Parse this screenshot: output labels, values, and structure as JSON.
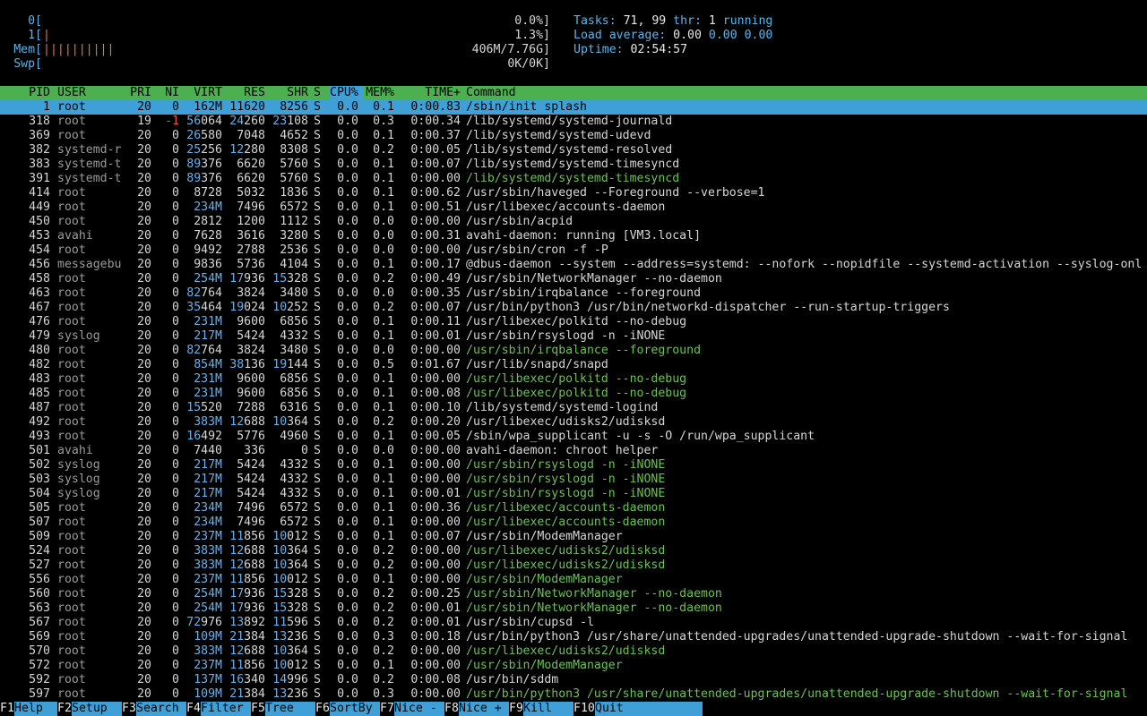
{
  "meters": {
    "cpu0": {
      "label": "0[",
      "value": "0.0%]"
    },
    "cpu1": {
      "label": "1[",
      "bar": "|",
      "value": "1.3%]"
    },
    "mem": {
      "label": "Mem[",
      "bar": "||||||||||",
      "value": "406M/7.76G]"
    },
    "swp": {
      "label": "Swp[",
      "value": "0K/0K]"
    }
  },
  "stats": {
    "tasks_label": "Tasks: ",
    "tasks_value": "71, 99",
    "thr_label": " thr: ",
    "thr_value": "1",
    "running": " running",
    "load_label": "Load average: ",
    "load1": "0.00",
    "load5": "0.00",
    "load15": "0.00",
    "uptime_label": "Uptime: ",
    "uptime_value": "02:54:57"
  },
  "columns": [
    "PID",
    "USER",
    "PRI",
    "NI",
    "VIRT",
    "RES",
    "SHR",
    "S",
    "CPU%",
    "MEM%",
    "TIME+",
    "Command"
  ],
  "sort_column": "CPU%",
  "processes": [
    {
      "pid": "1",
      "user": "root",
      "pri": "20",
      "ni": "0",
      "virt": "162M",
      "res": "11620",
      "shr": "8256",
      "s": "S",
      "cpu": "0.0",
      "mem": "0.1",
      "time": "0:00.83",
      "cmd": "/sbin/init splash",
      "thread": false,
      "selected": true
    },
    {
      "pid": "318",
      "user": "root",
      "pri": "19",
      "ni": "-1",
      "virt": "56064",
      "res": "24260",
      "shr": "23108",
      "s": "S",
      "cpu": "0.0",
      "mem": "0.3",
      "time": "0:00.34",
      "cmd": "/lib/systemd/systemd-journald",
      "thread": false
    },
    {
      "pid": "369",
      "user": "root",
      "pri": "20",
      "ni": "0",
      "virt": "26580",
      "res": "7048",
      "shr": "4652",
      "s": "S",
      "cpu": "0.0",
      "mem": "0.1",
      "time": "0:00.37",
      "cmd": "/lib/systemd/systemd-udevd",
      "thread": false
    },
    {
      "pid": "382",
      "user": "systemd-r",
      "pri": "20",
      "ni": "0",
      "virt": "25256",
      "res": "12280",
      "shr": "8308",
      "s": "S",
      "cpu": "0.0",
      "mem": "0.2",
      "time": "0:00.05",
      "cmd": "/lib/systemd/systemd-resolved",
      "thread": false
    },
    {
      "pid": "383",
      "user": "systemd-t",
      "pri": "20",
      "ni": "0",
      "virt": "89376",
      "res": "6620",
      "shr": "5760",
      "s": "S",
      "cpu": "0.0",
      "mem": "0.1",
      "time": "0:00.07",
      "cmd": "/lib/systemd/systemd-timesyncd",
      "thread": false
    },
    {
      "pid": "391",
      "user": "systemd-t",
      "pri": "20",
      "ni": "0",
      "virt": "89376",
      "res": "6620",
      "shr": "5760",
      "s": "S",
      "cpu": "0.0",
      "mem": "0.1",
      "time": "0:00.00",
      "cmd": "/lib/systemd/systemd-timesyncd",
      "thread": true
    },
    {
      "pid": "414",
      "user": "root",
      "pri": "20",
      "ni": "0",
      "virt": "8728",
      "res": "5032",
      "shr": "1836",
      "s": "S",
      "cpu": "0.0",
      "mem": "0.1",
      "time": "0:00.62",
      "cmd": "/usr/sbin/haveged --Foreground --verbose=1",
      "thread": false
    },
    {
      "pid": "449",
      "user": "root",
      "pri": "20",
      "ni": "0",
      "virt": "234M",
      "res": "7496",
      "shr": "6572",
      "s": "S",
      "cpu": "0.0",
      "mem": "0.1",
      "time": "0:00.51",
      "cmd": "/usr/libexec/accounts-daemon",
      "thread": false
    },
    {
      "pid": "450",
      "user": "root",
      "pri": "20",
      "ni": "0",
      "virt": "2812",
      "res": "1200",
      "shr": "1112",
      "s": "S",
      "cpu": "0.0",
      "mem": "0.0",
      "time": "0:00.00",
      "cmd": "/usr/sbin/acpid",
      "thread": false
    },
    {
      "pid": "453",
      "user": "avahi",
      "pri": "20",
      "ni": "0",
      "virt": "7628",
      "res": "3616",
      "shr": "3280",
      "s": "S",
      "cpu": "0.0",
      "mem": "0.0",
      "time": "0:00.31",
      "cmd": "avahi-daemon: running [VM3.local]",
      "thread": false
    },
    {
      "pid": "454",
      "user": "root",
      "pri": "20",
      "ni": "0",
      "virt": "9492",
      "res": "2788",
      "shr": "2536",
      "s": "S",
      "cpu": "0.0",
      "mem": "0.0",
      "time": "0:00.00",
      "cmd": "/usr/sbin/cron -f -P",
      "thread": false
    },
    {
      "pid": "456",
      "user": "messagebu",
      "pri": "20",
      "ni": "0",
      "virt": "9836",
      "res": "5736",
      "shr": "4104",
      "s": "S",
      "cpu": "0.0",
      "mem": "0.1",
      "time": "0:00.17",
      "cmd": "@dbus-daemon --system --address=systemd: --nofork --nopidfile --systemd-activation --syslog-onl",
      "thread": false
    },
    {
      "pid": "458",
      "user": "root",
      "pri": "20",
      "ni": "0",
      "virt": "254M",
      "res": "17936",
      "shr": "15328",
      "s": "S",
      "cpu": "0.0",
      "mem": "0.2",
      "time": "0:00.49",
      "cmd": "/usr/sbin/NetworkManager --no-daemon",
      "thread": false
    },
    {
      "pid": "463",
      "user": "root",
      "pri": "20",
      "ni": "0",
      "virt": "82764",
      "res": "3824",
      "shr": "3480",
      "s": "S",
      "cpu": "0.0",
      "mem": "0.0",
      "time": "0:00.35",
      "cmd": "/usr/sbin/irqbalance --foreground",
      "thread": false
    },
    {
      "pid": "467",
      "user": "root",
      "pri": "20",
      "ni": "0",
      "virt": "35464",
      "res": "19024",
      "shr": "10252",
      "s": "S",
      "cpu": "0.0",
      "mem": "0.2",
      "time": "0:00.07",
      "cmd": "/usr/bin/python3 /usr/bin/networkd-dispatcher --run-startup-triggers",
      "thread": false
    },
    {
      "pid": "476",
      "user": "root",
      "pri": "20",
      "ni": "0",
      "virt": "231M",
      "res": "9600",
      "shr": "6856",
      "s": "S",
      "cpu": "0.0",
      "mem": "0.1",
      "time": "0:00.11",
      "cmd": "/usr/libexec/polkitd --no-debug",
      "thread": false
    },
    {
      "pid": "479",
      "user": "syslog",
      "pri": "20",
      "ni": "0",
      "virt": "217M",
      "res": "5424",
      "shr": "4332",
      "s": "S",
      "cpu": "0.0",
      "mem": "0.1",
      "time": "0:00.01",
      "cmd": "/usr/sbin/rsyslogd -n -iNONE",
      "thread": false
    },
    {
      "pid": "480",
      "user": "root",
      "pri": "20",
      "ni": "0",
      "virt": "82764",
      "res": "3824",
      "shr": "3480",
      "s": "S",
      "cpu": "0.0",
      "mem": "0.0",
      "time": "0:00.00",
      "cmd": "/usr/sbin/irqbalance --foreground",
      "thread": true
    },
    {
      "pid": "482",
      "user": "root",
      "pri": "20",
      "ni": "0",
      "virt": "854M",
      "res": "38136",
      "shr": "19144",
      "s": "S",
      "cpu": "0.0",
      "mem": "0.5",
      "time": "0:01.67",
      "cmd": "/usr/lib/snapd/snapd",
      "thread": false
    },
    {
      "pid": "483",
      "user": "root",
      "pri": "20",
      "ni": "0",
      "virt": "231M",
      "res": "9600",
      "shr": "6856",
      "s": "S",
      "cpu": "0.0",
      "mem": "0.1",
      "time": "0:00.00",
      "cmd": "/usr/libexec/polkitd --no-debug",
      "thread": true
    },
    {
      "pid": "485",
      "user": "root",
      "pri": "20",
      "ni": "0",
      "virt": "231M",
      "res": "9600",
      "shr": "6856",
      "s": "S",
      "cpu": "0.0",
      "mem": "0.1",
      "time": "0:00.08",
      "cmd": "/usr/libexec/polkitd --no-debug",
      "thread": true
    },
    {
      "pid": "487",
      "user": "root",
      "pri": "20",
      "ni": "0",
      "virt": "15520",
      "res": "7288",
      "shr": "6316",
      "s": "S",
      "cpu": "0.0",
      "mem": "0.1",
      "time": "0:00.10",
      "cmd": "/lib/systemd/systemd-logind",
      "thread": false
    },
    {
      "pid": "492",
      "user": "root",
      "pri": "20",
      "ni": "0",
      "virt": "383M",
      "res": "12688",
      "shr": "10364",
      "s": "S",
      "cpu": "0.0",
      "mem": "0.2",
      "time": "0:00.20",
      "cmd": "/usr/libexec/udisks2/udisksd",
      "thread": false
    },
    {
      "pid": "493",
      "user": "root",
      "pri": "20",
      "ni": "0",
      "virt": "16492",
      "res": "5776",
      "shr": "4960",
      "s": "S",
      "cpu": "0.0",
      "mem": "0.1",
      "time": "0:00.05",
      "cmd": "/sbin/wpa_supplicant -u -s -O /run/wpa_supplicant",
      "thread": false
    },
    {
      "pid": "501",
      "user": "avahi",
      "pri": "20",
      "ni": "0",
      "virt": "7440",
      "res": "336",
      "shr": "0",
      "s": "S",
      "cpu": "0.0",
      "mem": "0.0",
      "time": "0:00.00",
      "cmd": "avahi-daemon: chroot helper",
      "thread": false
    },
    {
      "pid": "502",
      "user": "syslog",
      "pri": "20",
      "ni": "0",
      "virt": "217M",
      "res": "5424",
      "shr": "4332",
      "s": "S",
      "cpu": "0.0",
      "mem": "0.1",
      "time": "0:00.00",
      "cmd": "/usr/sbin/rsyslogd -n -iNONE",
      "thread": true
    },
    {
      "pid": "503",
      "user": "syslog",
      "pri": "20",
      "ni": "0",
      "virt": "217M",
      "res": "5424",
      "shr": "4332",
      "s": "S",
      "cpu": "0.0",
      "mem": "0.1",
      "time": "0:00.00",
      "cmd": "/usr/sbin/rsyslogd -n -iNONE",
      "thread": true
    },
    {
      "pid": "504",
      "user": "syslog",
      "pri": "20",
      "ni": "0",
      "virt": "217M",
      "res": "5424",
      "shr": "4332",
      "s": "S",
      "cpu": "0.0",
      "mem": "0.1",
      "time": "0:00.01",
      "cmd": "/usr/sbin/rsyslogd -n -iNONE",
      "thread": true
    },
    {
      "pid": "505",
      "user": "root",
      "pri": "20",
      "ni": "0",
      "virt": "234M",
      "res": "7496",
      "shr": "6572",
      "s": "S",
      "cpu": "0.0",
      "mem": "0.1",
      "time": "0:00.36",
      "cmd": "/usr/libexec/accounts-daemon",
      "thread": true
    },
    {
      "pid": "507",
      "user": "root",
      "pri": "20",
      "ni": "0",
      "virt": "234M",
      "res": "7496",
      "shr": "6572",
      "s": "S",
      "cpu": "0.0",
      "mem": "0.1",
      "time": "0:00.00",
      "cmd": "/usr/libexec/accounts-daemon",
      "thread": true
    },
    {
      "pid": "509",
      "user": "root",
      "pri": "20",
      "ni": "0",
      "virt": "237M",
      "res": "11856",
      "shr": "10012",
      "s": "S",
      "cpu": "0.0",
      "mem": "0.1",
      "time": "0:00.07",
      "cmd": "/usr/sbin/ModemManager",
      "thread": false
    },
    {
      "pid": "524",
      "user": "root",
      "pri": "20",
      "ni": "0",
      "virt": "383M",
      "res": "12688",
      "shr": "10364",
      "s": "S",
      "cpu": "0.0",
      "mem": "0.2",
      "time": "0:00.00",
      "cmd": "/usr/libexec/udisks2/udisksd",
      "thread": true
    },
    {
      "pid": "527",
      "user": "root",
      "pri": "20",
      "ni": "0",
      "virt": "383M",
      "res": "12688",
      "shr": "10364",
      "s": "S",
      "cpu": "0.0",
      "mem": "0.2",
      "time": "0:00.00",
      "cmd": "/usr/libexec/udisks2/udisksd",
      "thread": true
    },
    {
      "pid": "556",
      "user": "root",
      "pri": "20",
      "ni": "0",
      "virt": "237M",
      "res": "11856",
      "shr": "10012",
      "s": "S",
      "cpu": "0.0",
      "mem": "0.1",
      "time": "0:00.00",
      "cmd": "/usr/sbin/ModemManager",
      "thread": true
    },
    {
      "pid": "560",
      "user": "root",
      "pri": "20",
      "ni": "0",
      "virt": "254M",
      "res": "17936",
      "shr": "15328",
      "s": "S",
      "cpu": "0.0",
      "mem": "0.2",
      "time": "0:00.25",
      "cmd": "/usr/sbin/NetworkManager --no-daemon",
      "thread": true
    },
    {
      "pid": "563",
      "user": "root",
      "pri": "20",
      "ni": "0",
      "virt": "254M",
      "res": "17936",
      "shr": "15328",
      "s": "S",
      "cpu": "0.0",
      "mem": "0.2",
      "time": "0:00.01",
      "cmd": "/usr/sbin/NetworkManager --no-daemon",
      "thread": true
    },
    {
      "pid": "567",
      "user": "root",
      "pri": "20",
      "ni": "0",
      "virt": "72976",
      "res": "13892",
      "shr": "11596",
      "s": "S",
      "cpu": "0.0",
      "mem": "0.2",
      "time": "0:00.01",
      "cmd": "/usr/sbin/cupsd -l",
      "thread": false
    },
    {
      "pid": "569",
      "user": "root",
      "pri": "20",
      "ni": "0",
      "virt": "109M",
      "res": "21384",
      "shr": "13236",
      "s": "S",
      "cpu": "0.0",
      "mem": "0.3",
      "time": "0:00.18",
      "cmd": "/usr/bin/python3 /usr/share/unattended-upgrades/unattended-upgrade-shutdown --wait-for-signal",
      "thread": false
    },
    {
      "pid": "570",
      "user": "root",
      "pri": "20",
      "ni": "0",
      "virt": "383M",
      "res": "12688",
      "shr": "10364",
      "s": "S",
      "cpu": "0.0",
      "mem": "0.2",
      "time": "0:00.00",
      "cmd": "/usr/libexec/udisks2/udisksd",
      "thread": true
    },
    {
      "pid": "572",
      "user": "root",
      "pri": "20",
      "ni": "0",
      "virt": "237M",
      "res": "11856",
      "shr": "10012",
      "s": "S",
      "cpu": "0.0",
      "mem": "0.1",
      "time": "0:00.00",
      "cmd": "/usr/sbin/ModemManager",
      "thread": true
    },
    {
      "pid": "592",
      "user": "root",
      "pri": "20",
      "ni": "0",
      "virt": "137M",
      "res": "16340",
      "shr": "14996",
      "s": "S",
      "cpu": "0.0",
      "mem": "0.2",
      "time": "0:00.08",
      "cmd": "/usr/bin/sddm",
      "thread": false
    },
    {
      "pid": "597",
      "user": "root",
      "pri": "20",
      "ni": "0",
      "virt": "109M",
      "res": "21384",
      "shr": "13236",
      "s": "S",
      "cpu": "0.0",
      "mem": "0.3",
      "time": "0:00.00",
      "cmd": "/usr/bin/python3 /usr/share/unattended-upgrades/unattended-upgrade-shutdown --wait-for-signal",
      "thread": true
    }
  ],
  "footer": [
    {
      "key": "F1",
      "label": "Help"
    },
    {
      "key": "F2",
      "label": "Setup"
    },
    {
      "key": "F3",
      "label": "Search"
    },
    {
      "key": "F4",
      "label": "Filter"
    },
    {
      "key": "F5",
      "label": "Tree"
    },
    {
      "key": "F6",
      "label": "SortBy"
    },
    {
      "key": "F7",
      "label": "Nice -"
    },
    {
      "key": "F8",
      "label": "Nice +"
    },
    {
      "key": "F9",
      "label": "Kill"
    },
    {
      "key": "F10",
      "label": "Quit"
    }
  ],
  "colors": {
    "header_bg": "#4caf50",
    "selection_bg": "#3fa0d8",
    "thread_text": "#6fbf5a",
    "label_cyan": "#5fb3e6",
    "bar_orange": "#e07a3c",
    "negative_nice": "#e05a4a"
  }
}
